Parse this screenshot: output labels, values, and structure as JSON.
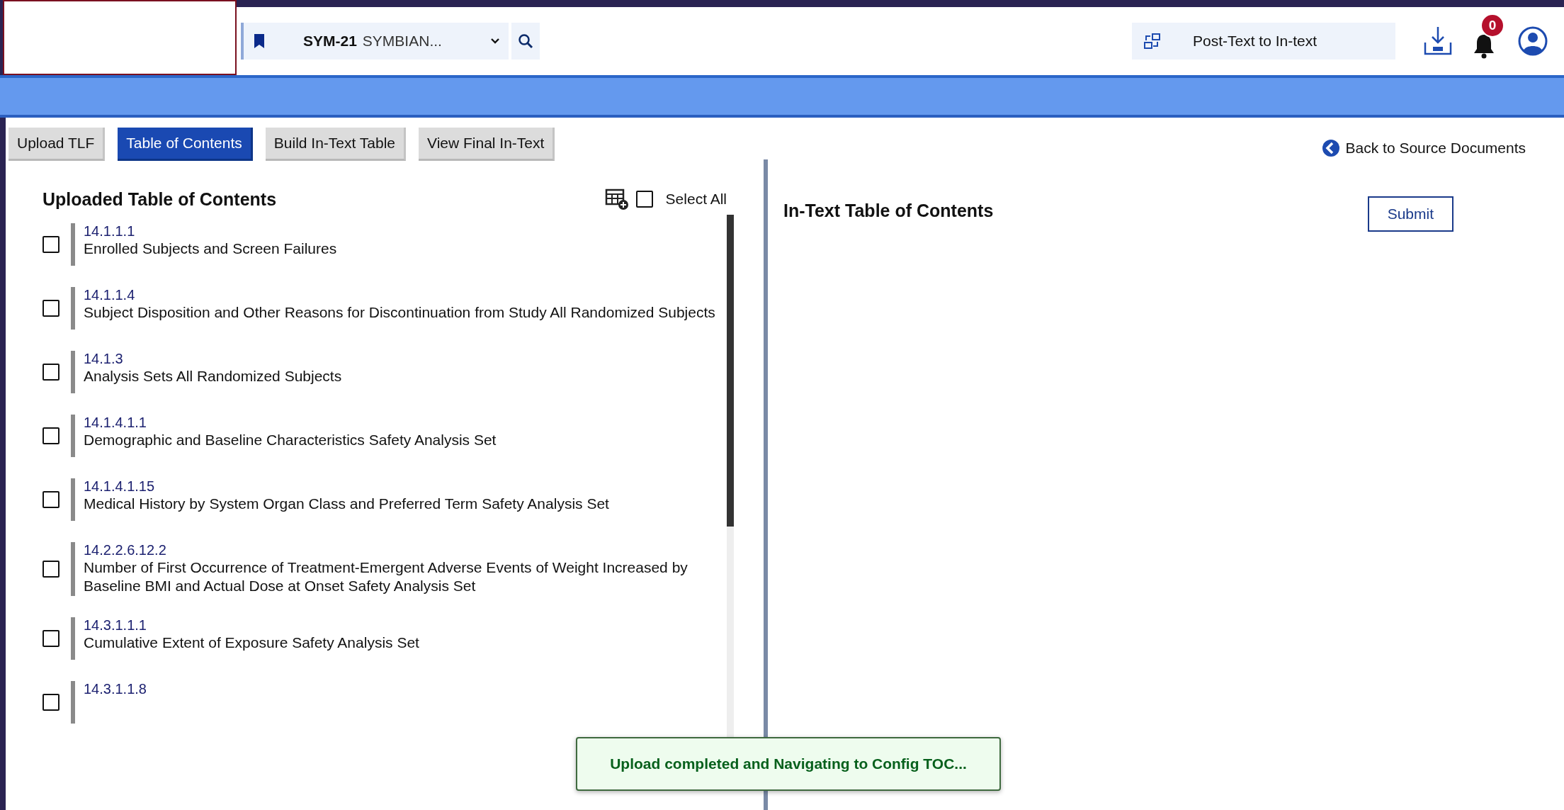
{
  "header": {
    "study_code": "SYM-21",
    "study_name": "SYMBIAN...",
    "mode_label": "Post-Text to In-text",
    "notification_count": "0"
  },
  "tabs": [
    {
      "label": "Upload TLF",
      "selected": false
    },
    {
      "label": "Table of Contents",
      "selected": true
    },
    {
      "label": "Build In-Text Table",
      "selected": false
    },
    {
      "label": "View Final In-Text",
      "selected": false
    }
  ],
  "back_link": "Back to Source Documents",
  "uploaded_toc": {
    "title": "Uploaded Table of Contents",
    "select_all": {
      "label": "Select All",
      "checked": false
    },
    "items": [
      {
        "number": "14.1.1.1",
        "title": "Enrolled Subjects and Screen Failures",
        "checked": false
      },
      {
        "number": "14.1.1.4",
        "title": "Subject Disposition and Other Reasons for Discontinuation from Study All Randomized Subjects",
        "checked": false
      },
      {
        "number": "14.1.3",
        "title": "Analysis Sets All Randomized Subjects",
        "checked": false
      },
      {
        "number": "14.1.4.1.1",
        "title": "Demographic and Baseline Characteristics Safety Analysis Set",
        "checked": false
      },
      {
        "number": "14.1.4.1.15",
        "title": "Medical History by System Organ Class and Preferred Term Safety Analysis Set",
        "checked": false
      },
      {
        "number": "14.2.2.6.12.2",
        "title": "Number of First Occurrence of Treatment-Emergent Adverse Events of Weight Increased by Baseline BMI and Actual Dose at Onset Safety Analysis Set",
        "checked": false
      },
      {
        "number": "14.3.1.1.1",
        "title": "Cumulative Extent of Exposure Safety Analysis Set",
        "checked": false
      },
      {
        "number": "14.3.1.1.8",
        "checked": false
      }
    ]
  },
  "in_text_toc": {
    "title": "In-Text Table of Contents",
    "submit": "Submit"
  },
  "toast": "Upload completed and Navigating to Config TOC..."
}
